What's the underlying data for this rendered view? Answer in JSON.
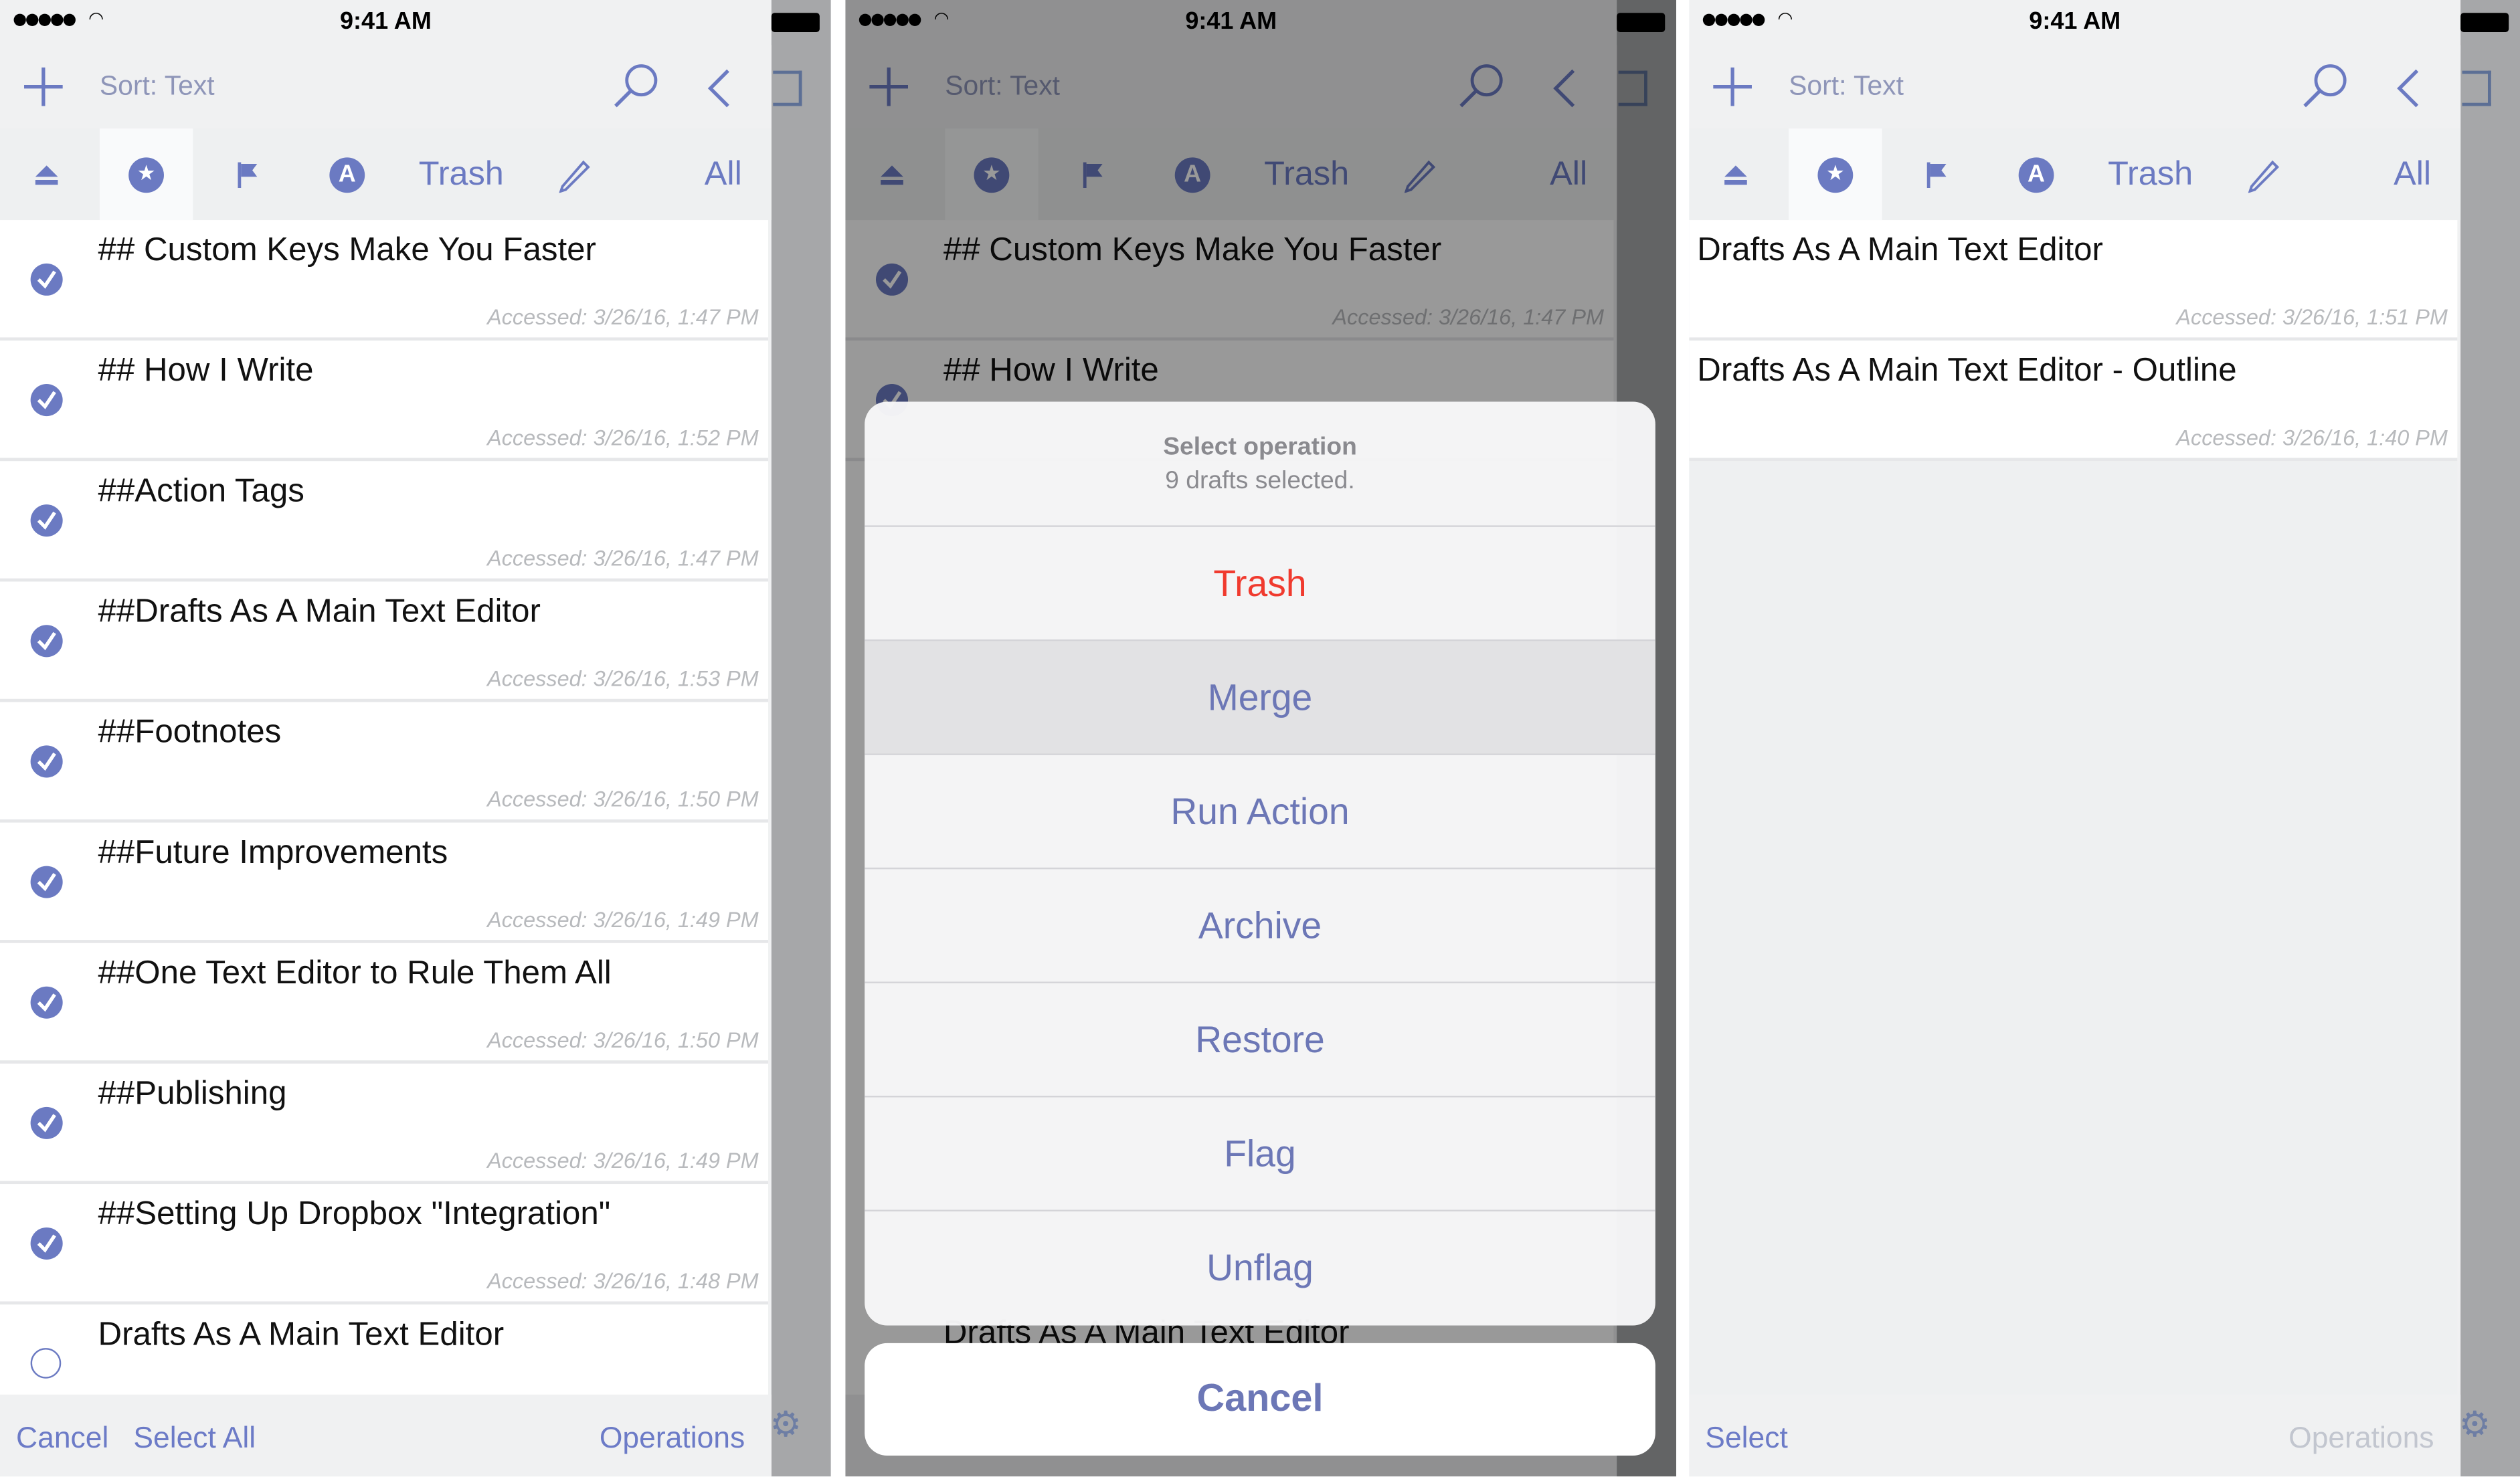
{
  "status": {
    "signal": "●●●●●",
    "time": "9:41 AM"
  },
  "nav": {
    "sort_label": "Sort: Text"
  },
  "filters": {
    "trash_label": "Trash",
    "all_label": "All"
  },
  "left": {
    "drafts": [
      {
        "title": "## Custom Keys Make You Faster",
        "accessed": "Accessed: 3/26/16, 1:47 PM",
        "selected": true
      },
      {
        "title": "## How I Write",
        "accessed": "Accessed: 3/26/16, 1:52 PM",
        "selected": true
      },
      {
        "title": "##Action Tags",
        "accessed": "Accessed: 3/26/16, 1:47 PM",
        "selected": true
      },
      {
        "title": "##Drafts As A Main Text Editor",
        "accessed": "Accessed: 3/26/16, 1:53 PM",
        "selected": true
      },
      {
        "title": "##Footnotes",
        "accessed": "Accessed: 3/26/16, 1:50 PM",
        "selected": true
      },
      {
        "title": "##Future Improvements",
        "accessed": "Accessed: 3/26/16, 1:49 PM",
        "selected": true
      },
      {
        "title": "##One Text Editor to Rule Them All",
        "accessed": "Accessed: 3/26/16, 1:50 PM",
        "selected": true
      },
      {
        "title": "##Publishing",
        "accessed": "Accessed: 3/26/16, 1:49 PM",
        "selected": true
      },
      {
        "title": "##Setting Up Dropbox \"Integration\"",
        "accessed": "Accessed: 3/26/16, 1:48 PM",
        "selected": true
      },
      {
        "title": "Drafts As A Main Text Editor",
        "accessed": "",
        "selected": false
      }
    ],
    "toolbar": {
      "cancel": "Cancel",
      "select_all": "Select All",
      "operations": "Operations"
    }
  },
  "middle": {
    "drafts": [
      {
        "title": "## Custom Keys Make You Faster",
        "accessed": "Accessed: 3/26/16, 1:47 PM"
      },
      {
        "title": "## How I Write",
        "accessed": ""
      }
    ],
    "peek_title": "Drafts As A Main Text Editor",
    "sheet": {
      "title": "Select operation",
      "message": "9 drafts selected.",
      "options": [
        "Trash",
        "Merge",
        "Run Action",
        "Archive",
        "Restore",
        "Flag",
        "Unflag"
      ],
      "highlighted": "Merge",
      "cancel": "Cancel"
    }
  },
  "right": {
    "drafts": [
      {
        "title": "Drafts As A Main Text Editor",
        "accessed": "Accessed: 3/26/16, 1:51 PM"
      },
      {
        "title": "Drafts As A Main Text Editor - Outline",
        "accessed": "Accessed: 3/26/16, 1:40 PM"
      }
    ],
    "toolbar": {
      "select": "Select",
      "operations": "Operations"
    }
  },
  "colors": {
    "accent": "#6b7ac2",
    "destructive": "#f03a2e"
  }
}
